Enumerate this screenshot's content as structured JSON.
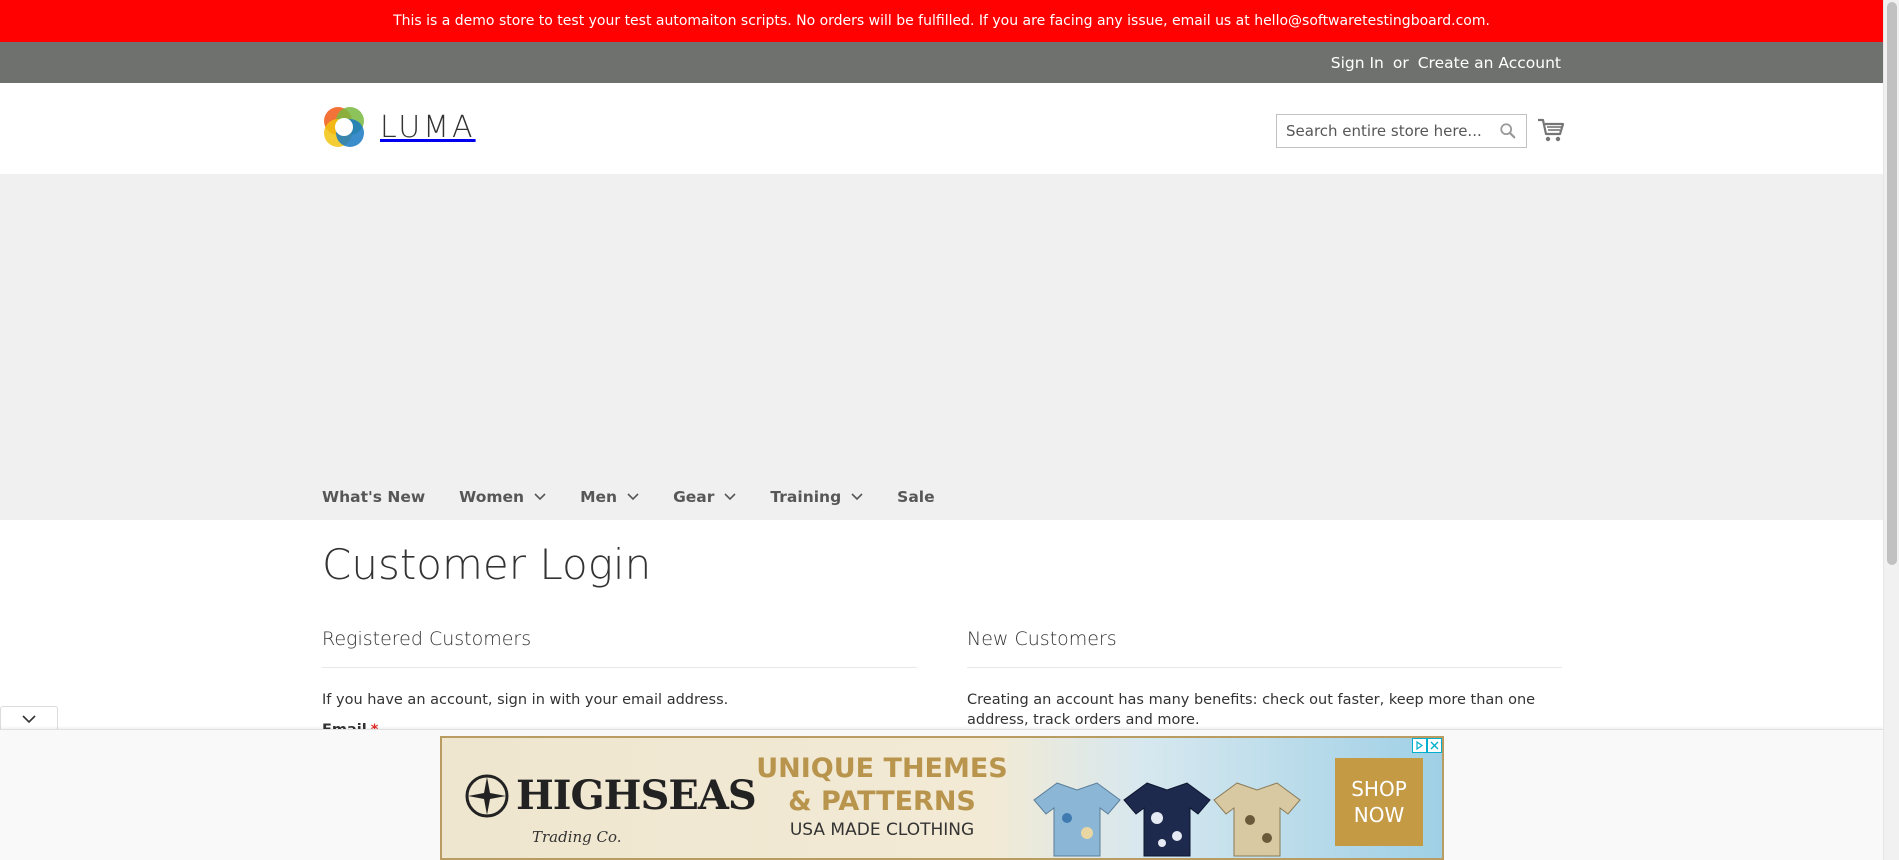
{
  "demo_notice": "This is a demo store to test your test automaiton scripts. No orders will be fulfilled. If you are facing any issue, email us at hello@softwaretestingboard.com.",
  "header_links": {
    "sign_in": "Sign In",
    "or": "or",
    "create_account": "Create an Account"
  },
  "logo": {
    "text": "LUMA",
    "icon": "luma-logo-icon"
  },
  "search": {
    "placeholder": "Search entire store here...",
    "icon": "search-icon"
  },
  "cart": {
    "icon": "cart-icon"
  },
  "nav": [
    {
      "label": "What's New",
      "has_dropdown": false
    },
    {
      "label": "Women",
      "has_dropdown": true
    },
    {
      "label": "Men",
      "has_dropdown": true
    },
    {
      "label": "Gear",
      "has_dropdown": true
    },
    {
      "label": "Training",
      "has_dropdown": true
    },
    {
      "label": "Sale",
      "has_dropdown": false
    }
  ],
  "page_title": "Customer Login",
  "registered": {
    "heading": "Registered Customers",
    "text": "If you have an account, sign in with your email address.",
    "email_label": "Email",
    "required_mark": "*"
  },
  "new_customers": {
    "heading": "New Customers",
    "text": "Creating an account has many benefits: check out faster, keep more than one address, track orders and more."
  },
  "ad": {
    "brand": "HIGHSEAS",
    "brand_sub": "Trading Co.",
    "headline_line1": "UNIQUE THEMES",
    "headline_line2": "& PATTERNS",
    "subline": "USA MADE CLOTHING",
    "cta_line1": "SHOP",
    "cta_line2": "NOW"
  },
  "colors": {
    "demo_banner": "#ff0101",
    "panel_header": "#6e716e",
    "hero": "#f0f0f0",
    "ad_gold": "#c49a45"
  }
}
